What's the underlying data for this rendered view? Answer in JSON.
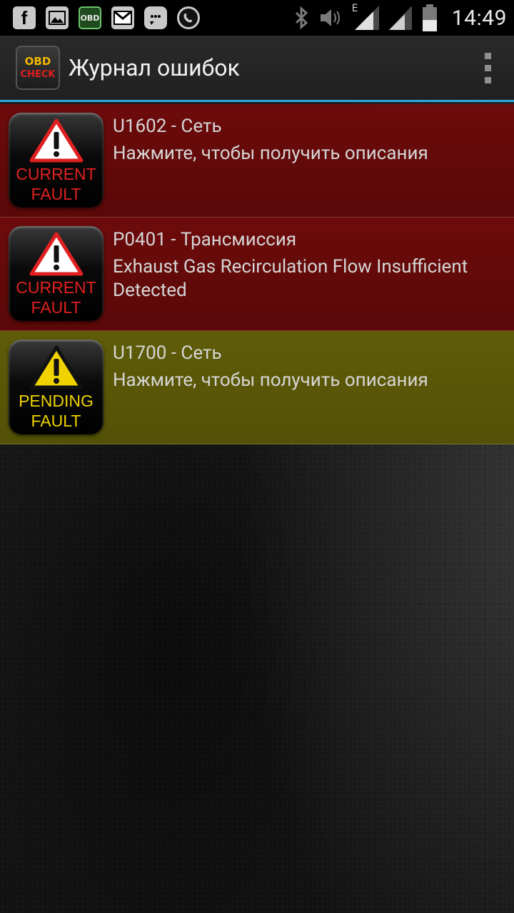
{
  "status_bar": {
    "time": "14:49",
    "network_type": "E",
    "notification_icons": [
      "facebook-icon",
      "gallery-icon",
      "obd-icon",
      "gmail-icon",
      "message-icon",
      "viber-icon"
    ],
    "system_icons": [
      "bluetooth-icon",
      "volume-icon",
      "signal-icon",
      "signal-2-icon",
      "battery-icon"
    ],
    "obd_label": "OBD"
  },
  "action_bar": {
    "title": "Журнал ошибок",
    "logo": {
      "top": "OBD",
      "bottom": "CHECK"
    }
  },
  "faults": [
    {
      "type": "current",
      "badge_line1": "CURRENT",
      "badge_line2": "FAULT",
      "code": "U1602 - Сеть",
      "description": "Нажмите, чтобы получить описания"
    },
    {
      "type": "current",
      "badge_line1": "CURRENT",
      "badge_line2": "FAULT",
      "code": "P0401 - Трансмиссия",
      "description": "Exhaust Gas Recirculation Flow Insufficient Detected"
    },
    {
      "type": "pending",
      "badge_line1": "PENDING",
      "badge_line2": "FAULT",
      "code": "U1700 - Сеть",
      "description": "Нажмите, чтобы получить описания"
    }
  ],
  "colors": {
    "current_row": "#6d0b0b",
    "pending_row": "#5f5d08",
    "current_badge_text": "#e02020",
    "pending_badge_text": "#f0d200",
    "accent_divider": "#33a3dc"
  }
}
